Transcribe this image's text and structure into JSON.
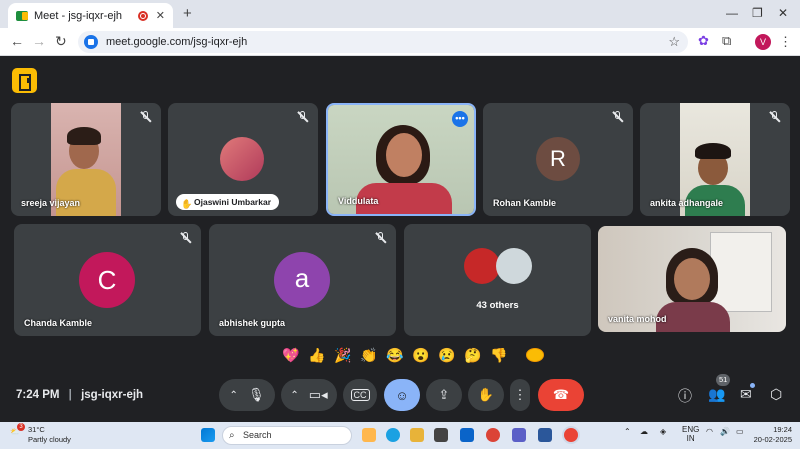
{
  "browser": {
    "tab_title": "Meet - jsg-iqxr-ejh",
    "tab_close": "✕",
    "new_tab": "+",
    "url": "meet.google.com/jsg-iqxr-ejh",
    "profile_initial": "V"
  },
  "meeting": {
    "time": "7:24 PM",
    "code": "jsg-iqxr-ejh",
    "people_count": "51"
  },
  "participants": [
    {
      "name": "sreeja vijayan"
    },
    {
      "name": "Ojaswini Umbarkar"
    },
    {
      "name": "Viddulata"
    },
    {
      "name": "Rohan Kamble",
      "initial": "R"
    },
    {
      "name": "ankita adhangale"
    },
    {
      "name": "Chanda Kamble",
      "initial": "C"
    },
    {
      "name": "abhishek gupta",
      "initial": "a"
    },
    {
      "name": "43 others"
    },
    {
      "name": "vanita mohod"
    }
  ],
  "reactions": [
    "💖",
    "👍",
    "🎉",
    "👏",
    "😂",
    "😮",
    "😢",
    "🤔",
    "👎"
  ],
  "taskbar": {
    "weather_temp": "31°C",
    "weather_desc": "Partly cloudy",
    "weather_alert": "3",
    "search_label": "Search",
    "lang": "ENG",
    "region": "IN",
    "time": "19:24",
    "date": "20-02-2025"
  },
  "colors": {
    "rohan": "#6d4c41",
    "chanda": "#c2185b",
    "abhishek": "#8e44ad",
    "end_call": "#ea4335",
    "active_button": "#8ab4f8"
  }
}
